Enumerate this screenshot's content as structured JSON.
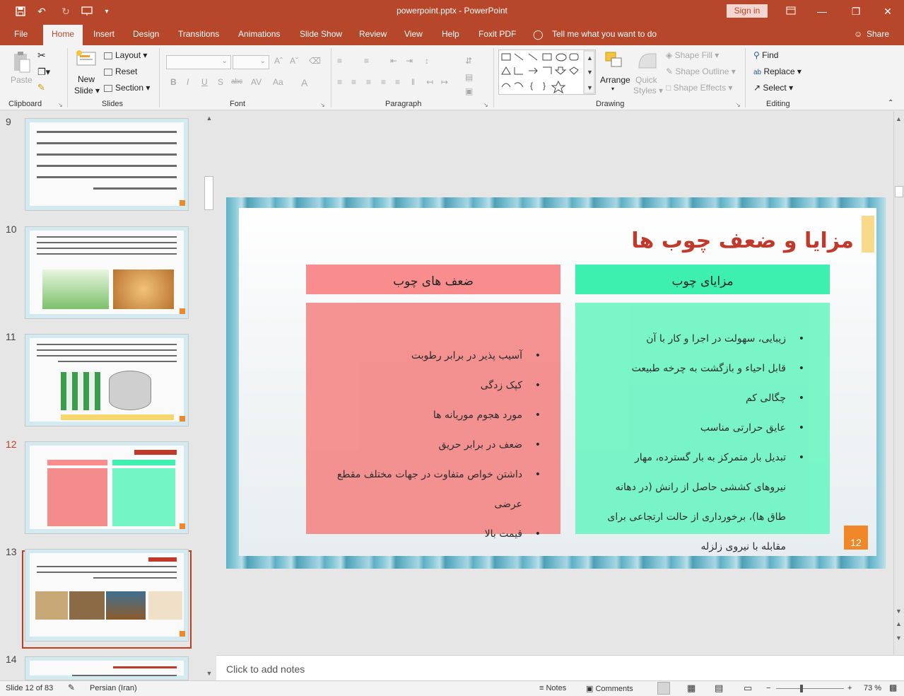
{
  "titlebar": {
    "title": "powerpoint.pptx  -  PowerPoint",
    "signin": "Sign in"
  },
  "tabs": [
    "File",
    "Home",
    "Insert",
    "Design",
    "Transitions",
    "Animations",
    "Slide Show",
    "Review",
    "View",
    "Help",
    "Foxit PDF"
  ],
  "tell_me": "Tell me what you want to do",
  "share": "Share",
  "ribbon": {
    "clipboard": {
      "paste": "Paste",
      "label": "Clipboard"
    },
    "slides": {
      "new_slide": "New",
      "new_slide2": "Slide",
      "layout": "Layout",
      "reset": "Reset",
      "section": "Section",
      "label": "Slides"
    },
    "font": {
      "label": "Font"
    },
    "paragraph": {
      "label": "Paragraph"
    },
    "drawing": {
      "arrange": "Arrange",
      "quick": "Quick",
      "styles": "Styles",
      "shape_fill": "Shape Fill",
      "shape_outline": "Shape Outline",
      "shape_effects": "Shape Effects",
      "label": "Drawing"
    },
    "editing": {
      "find": "Find",
      "replace": "Replace",
      "select": "Select",
      "label": "Editing"
    }
  },
  "thumbnails": {
    "numbers": [
      "9",
      "10",
      "11",
      "12",
      "13",
      "14"
    ],
    "selected": "12"
  },
  "slide": {
    "title": "مزایا و ضعف چوب ها",
    "advantages_header": "مزایای چوب",
    "weaknesses_header": "ضعف های چوب",
    "advantages": [
      "زیبایی، سهولت در اجرا و کار با آن",
      "قابل احیاء و بازگشت به چرخه طبیعت",
      "چگالی کم",
      "عایق حرارتی مناسب",
      "تبدیل بار متمرکز به بار گسترده، مهار نیروهای کششی حاصل از رانش (در دهانه طاق ها)، برخورداری از حالت ارتجاعی برای مقابله با نیروی زلزله"
    ],
    "weaknesses": [
      "آسیب پذیر در برابر رطوبت",
      "کپک زدگی",
      "مورد هجوم موریانه ها",
      "ضعف در برابر حریق",
      "داشتن خواص متفاوت در جهات مختلف مقطع عرضی",
      "قیمت بالا"
    ],
    "number": "12"
  },
  "notes_placeholder": "Click to add notes",
  "status": {
    "slide_info": "Slide 12 of 83",
    "language": "Persian (Iran)",
    "notes": "Notes",
    "comments": "Comments",
    "zoom": "73 %"
  }
}
